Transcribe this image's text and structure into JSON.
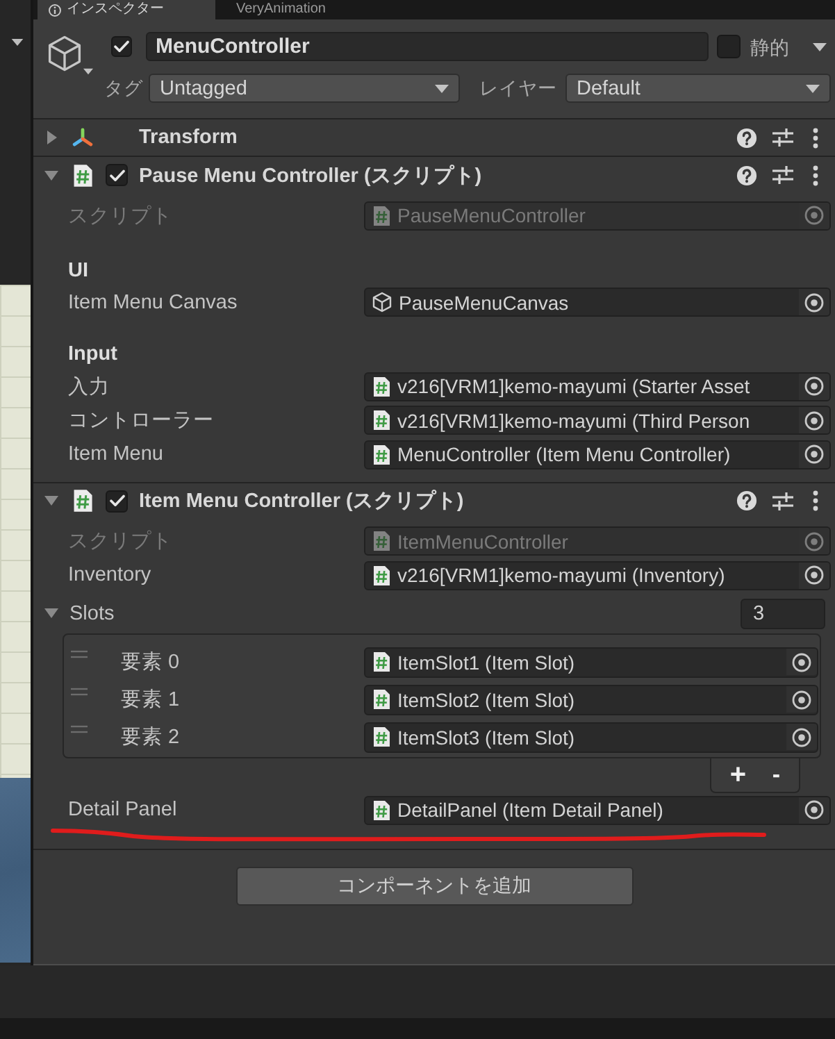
{
  "tabs": [
    {
      "label": "インスペクター",
      "selected": true
    },
    {
      "label": "VeryAnimation",
      "selected": false
    }
  ],
  "game_object": {
    "active": true,
    "name": "MenuController",
    "static": false,
    "static_label": "静的",
    "tag_label": "タグ",
    "tag": "Untagged",
    "layer_label": "レイヤー",
    "layer": "Default"
  },
  "components": [
    {
      "kind": "transform",
      "title": "Transform",
      "expanded": false
    },
    {
      "kind": "script",
      "title": "Pause Menu Controller (スクリプト)",
      "expanded": true,
      "enabled": true,
      "fields": [
        {
          "kind": "script_ref",
          "label": "スクリプト",
          "value": "PauseMenuController",
          "disabled": true,
          "underlined": false
        },
        {
          "kind": "header",
          "label": "UI",
          "disabled": false
        },
        {
          "kind": "object_ref",
          "label": "Item Menu Canvas",
          "value": "PauseMenuCanvas",
          "disabled": false,
          "underlined": false
        },
        {
          "kind": "header",
          "label": "Input",
          "disabled": false
        },
        {
          "kind": "script_ref",
          "label": "入力",
          "value": "v216[VRM1]kemo-mayumi (Starter Asset",
          "disabled": false,
          "underlined": false
        },
        {
          "kind": "script_ref",
          "label": "コントローラー",
          "value": "v216[VRM1]kemo-mayumi (Third Person",
          "disabled": false,
          "underlined": false
        },
        {
          "kind": "script_ref",
          "label": "Item Menu",
          "value": "MenuController (Item Menu Controller)",
          "disabled": false,
          "underlined": false
        }
      ]
    },
    {
      "kind": "script",
      "title": "Item Menu Controller (スクリプト)",
      "expanded": true,
      "enabled": true,
      "fields": [
        {
          "kind": "script_ref",
          "label": "スクリプト",
          "value": "ItemMenuController",
          "disabled": true,
          "underlined": false
        },
        {
          "kind": "script_ref",
          "label": "Inventory",
          "value": "v216[VRM1]kemo-mayumi (Inventory)",
          "disabled": false,
          "underlined": false
        },
        {
          "kind": "list",
          "label": "Slots",
          "expanded": true,
          "count": "3",
          "disabled": false,
          "underlined": false,
          "items": [
            {
              "kind": "script_ref",
              "label": "要素 0",
              "value": "ItemSlot1 (Item Slot)"
            },
            {
              "kind": "script_ref",
              "label": "要素 1",
              "value": "ItemSlot2 (Item Slot)"
            },
            {
              "kind": "script_ref",
              "label": "要素 2",
              "value": "ItemSlot3 (Item Slot)"
            }
          ],
          "buttons": [
            {
              "kind": "add",
              "label": "+"
            },
            {
              "kind": "remove",
              "label": "-"
            }
          ]
        },
        {
          "kind": "script_ref",
          "label": "Detail Panel",
          "value": "DetailPanel (Item Detail Panel)",
          "disabled": false,
          "underlined": true
        }
      ]
    }
  ],
  "add_component_button": "コンポーネントを追加"
}
